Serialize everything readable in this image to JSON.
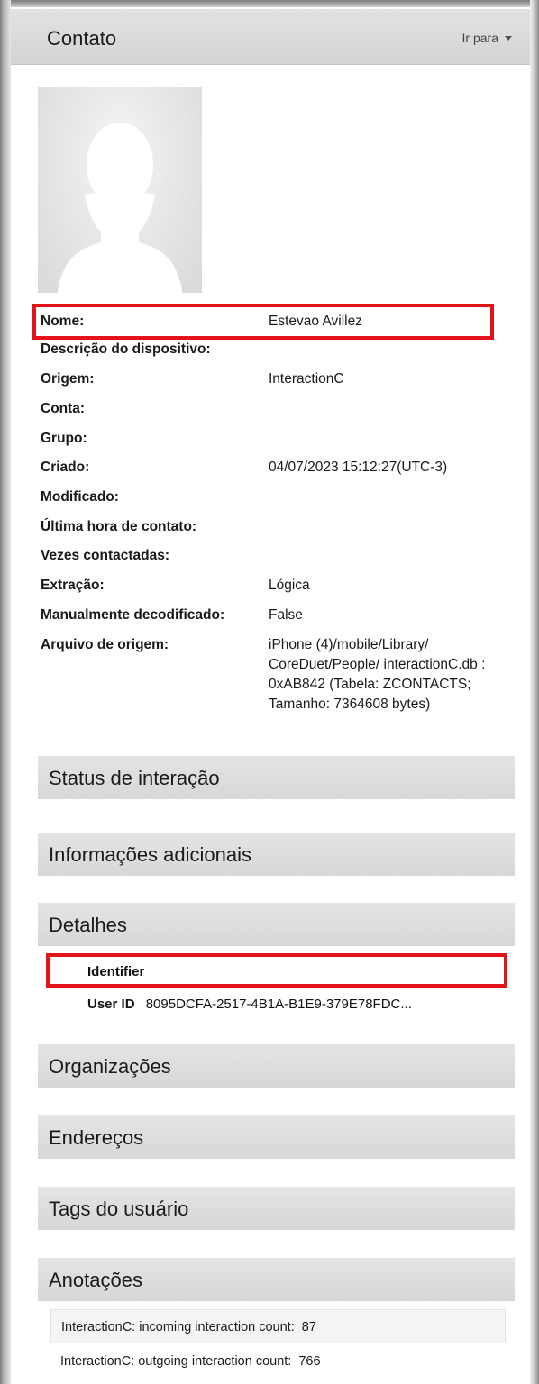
{
  "header": {
    "title": "Contato",
    "goto_label": "Ir para"
  },
  "avatar": {
    "icon": "person-silhouette-icon"
  },
  "properties": [
    {
      "label": "Nome:",
      "value": "Estevao Avillez"
    },
    {
      "label": "Descrição do dispositivo:",
      "value": ""
    },
    {
      "label": "Origem:",
      "value": "InteractionC"
    },
    {
      "label": "Conta:",
      "value": ""
    },
    {
      "label": "Grupo:",
      "value": ""
    },
    {
      "label": "Criado:",
      "value": "04/07/2023 15:12:27(UTC-3)"
    },
    {
      "label": "Modificado:",
      "value": ""
    },
    {
      "label": "Última hora de contato:",
      "value": ""
    },
    {
      "label": "Vezes contactadas:",
      "value": ""
    },
    {
      "label": "Extração:",
      "value": "Lógica"
    },
    {
      "label": "Manualmente decodificado:",
      "value": "False"
    },
    {
      "label": "Arquivo de origem:",
      "value": "iPhone (4)/mobile/Library/ CoreDuet/People/ interactionC.db : 0xAB842 (Tabela: ZCONTACTS; Tamanho: 7364608 bytes)"
    }
  ],
  "sections": {
    "status": "Status de interação",
    "additional": "Informações adicionais",
    "details": "Detalhes",
    "organizations": "Organizações",
    "addresses": "Endereços",
    "tags": "Tags do usuário",
    "annotations": "Anotações"
  },
  "details": {
    "identifier_label": "Identifier",
    "user_id_label": "User ID",
    "user_id_value": "8095DCFA-2517-4B1A-B1E9-379E78FDC..."
  },
  "annotations": [
    {
      "text": "InteractionC: incoming interaction count:",
      "value": "87"
    },
    {
      "text": "InteractionC: outgoing interaction count:",
      "value": "766"
    }
  ],
  "colors": {
    "highlight": "#e3131a",
    "section_bg": "#dcdcdc"
  }
}
